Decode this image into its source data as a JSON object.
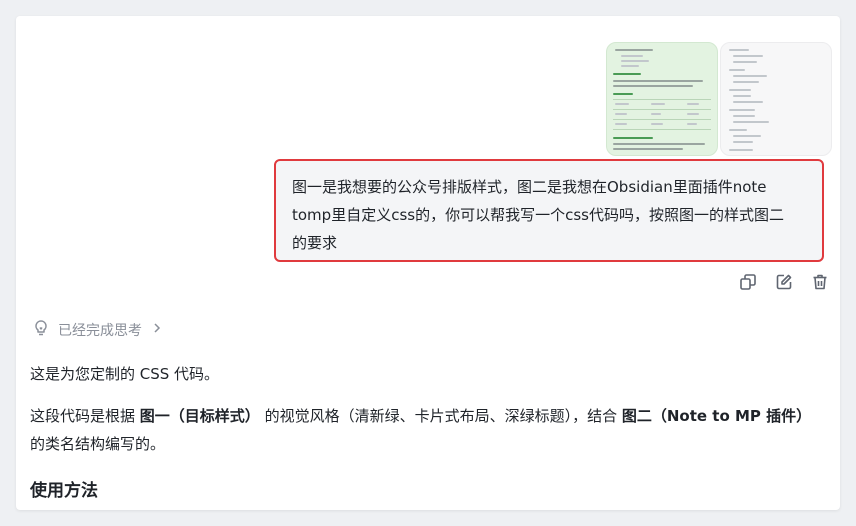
{
  "user_message": {
    "lines": [
      "图一是我想要的公众号排版样式，图二是我想在Obsidian里面插件note",
      "tomp里自定义css的，你可以帮我写一个css代码吗，按照图一的样式图二",
      "的要求"
    ]
  },
  "thinking": {
    "label": "已经完成思考",
    "icon": "lightbulb-icon"
  },
  "response": {
    "p1": "这是为您定制的 CSS 代码。",
    "p2": {
      "t1": "这段代码是根据 ",
      "b1": "图一（目标样式）",
      "t2": " 的视觉风格（清新绿、卡片式布局、深绿标题），结合 ",
      "b2": "图二（Note to MP 插件）",
      "t3": " 的类名结构编写的。"
    },
    "heading": "使用方法"
  },
  "actions": [
    "copy-icon",
    "edit-icon",
    "trash-icon"
  ],
  "colors": {
    "highlight_border": "#e03a3e",
    "thumb1_bg": "#e3f3e1",
    "thumb2_bg": "#f7f7f8",
    "accent_green": "#4a9b55"
  }
}
